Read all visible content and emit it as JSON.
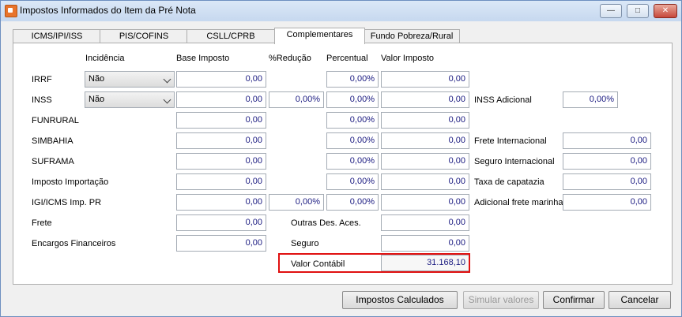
{
  "window": {
    "title": "Impostos Informados do Item da Pré Nota",
    "controls": {
      "minimize": "—",
      "maximize": "□",
      "close": "✕"
    }
  },
  "tabs": [
    "ICMS/IPI/ISS",
    "PIS/COFINS",
    "CSLL/CPRB",
    "Complementares",
    "Fundo Pobreza/Rural"
  ],
  "headers": {
    "incidencia": "Incidência",
    "base_imposto": "Base Imposto",
    "reducao": "%Redução",
    "percentual": "Percentual",
    "valor_imposto": "Valor Imposto"
  },
  "rows": {
    "irrf": {
      "label": "IRRF",
      "incidencia": "Não",
      "base": "0,00",
      "percentual": "0,00%",
      "valor": "0,00"
    },
    "inss": {
      "label": "INSS",
      "incidencia": "Não",
      "base": "0,00",
      "reducao": "0,00%",
      "percentual": "0,00%",
      "valor": "0,00"
    },
    "funrural": {
      "label": "FUNRURAL",
      "base": "0,00",
      "percentual": "0,00%",
      "valor": "0,00"
    },
    "simbahia": {
      "label": "SIMBAHIA",
      "base": "0,00",
      "percentual": "0,00%",
      "valor": "0,00"
    },
    "suframa": {
      "label": "SUFRAMA",
      "base": "0,00",
      "percentual": "0,00%",
      "valor": "0,00"
    },
    "imposto_importacao": {
      "label": "Imposto Importação",
      "base": "0,00",
      "percentual": "0,00%",
      "valor": "0,00"
    },
    "igi_icms": {
      "label": "IGI/ICMS Imp. PR",
      "base": "0,00",
      "reducao": "0,00%",
      "percentual": "0,00%",
      "valor": "0,00"
    },
    "frete": {
      "label": "Frete",
      "base": "0,00"
    },
    "encargos": {
      "label": "Encargos Financeiros",
      "base": "0,00"
    }
  },
  "middle": {
    "outras_label": "Outras Des. Aces.",
    "outras_value": "0,00",
    "seguro_label": "Seguro",
    "seguro_value": "0,00",
    "valor_contabil_label": "Valor Contábil",
    "valor_contabil_value": "31.168,10"
  },
  "right": {
    "inss_adicional": {
      "label": "INSS Adicional",
      "value": "0,00%"
    },
    "frete_internacional": {
      "label": "Frete Internacional",
      "value": "0,00"
    },
    "seguro_internacional": {
      "label": "Seguro Internacional",
      "value": "0,00"
    },
    "taxa_capatazia": {
      "label": "Taxa de capatazia",
      "value": "0,00"
    },
    "adicional_frete_marinha": {
      "label": "Adicional frete marinha",
      "value": "0,00"
    }
  },
  "buttons": {
    "impostos_calculados": "Impostos Calculados",
    "simular_valores": "Simular valores",
    "confirmar": "Confirmar",
    "cancelar": "Cancelar"
  }
}
